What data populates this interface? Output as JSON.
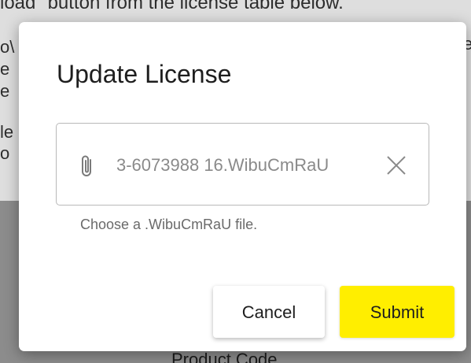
{
  "background": {
    "top_line": "load\" button from the license table below.",
    "left_fragments": [
      "o\\",
      "e",
      "e",
      "le",
      "o"
    ],
    "right_fragment": "e",
    "footer_label": "Product Code"
  },
  "dialog": {
    "title": "Update License",
    "file_input": {
      "value": "3-6073988 16.WibuCmRaU",
      "attach_icon": "paperclip-icon",
      "clear_icon": "close-icon"
    },
    "helper_text": "Choose a .WibuCmRaU file.",
    "cancel_label": "Cancel",
    "submit_label": "Submit"
  },
  "colors": {
    "accent": "#ffee00",
    "overlay": "#8c8c8c",
    "field_border": "#b9b9b9"
  }
}
